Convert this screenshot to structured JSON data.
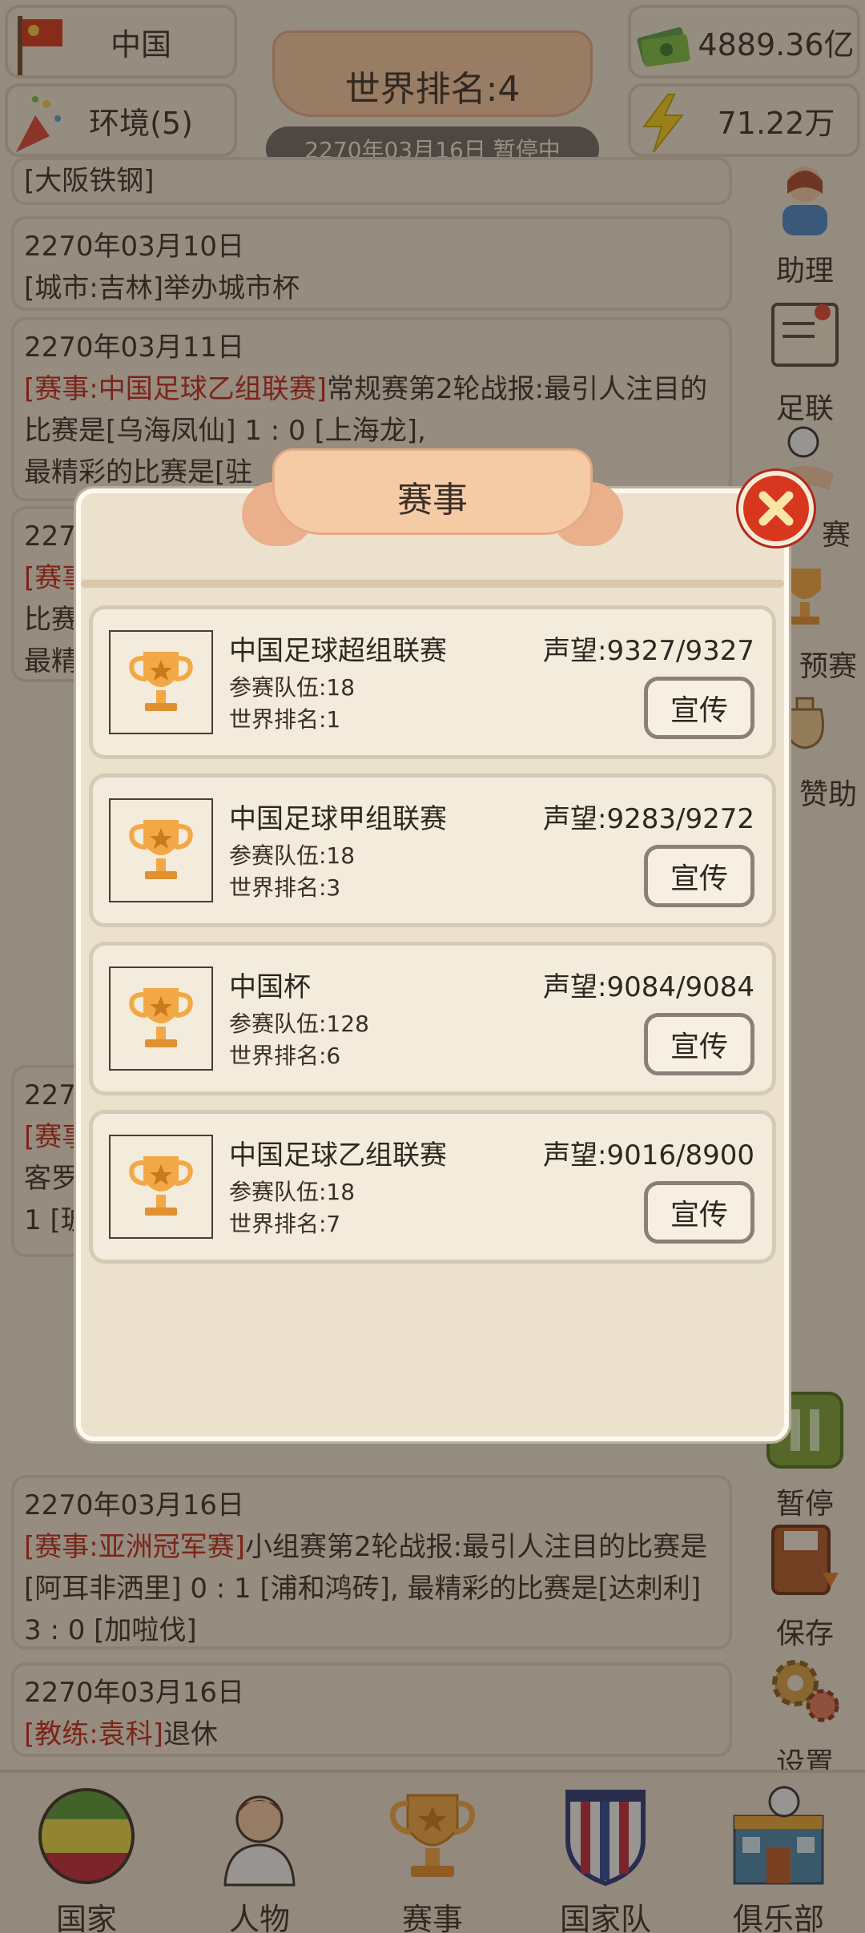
{
  "header": {
    "country_label": "中国",
    "environment_label": "环境(5)",
    "world_rank_title": "世界排名:4",
    "date_status": "2270年03月16日 暂停中",
    "money": "4889.36亿",
    "energy": "71.22万"
  },
  "news": [
    {
      "date": "",
      "tag": "",
      "text": "[大阪铁钢]"
    },
    {
      "date": "2270年03月10日",
      "tag": "",
      "text": "[城市:吉林]举办城市杯"
    },
    {
      "date": "2270年03月11日",
      "tag": "[赛事:中国足球乙组联赛]",
      "text": "常规赛第2轮战报:最引人注目的比赛是[乌海凤仙] 1 : 0 [上海龙],",
      "text2": "最精彩的比赛是[驻"
    },
    {
      "date": "2270年03月16日",
      "tag": "[赛事:亚洲冠军赛]",
      "text": "小组赛第2轮战报:最引人注目的比赛是[阿耳非洒里] 0 : 1 [浦和鸿砖], 最精彩的比赛是[达刺利] 3 : 0 [加啦伐]"
    },
    {
      "date": "2270年03月16日",
      "tag": "[教练:袁科]",
      "text": "退休"
    }
  ],
  "news_partial": [
    "2270",
    "[赛事",
    "比赛",
    "最精",
    "客罗",
    "1 [玻"
  ],
  "side_menu": {
    "assistant": "助理",
    "league": "足联",
    "match_fragment": "赛",
    "prelim_fragment": "预赛",
    "sponsor_fragment": "赞助",
    "pause": "暂停",
    "save": "保存",
    "settings": "设置"
  },
  "bottom_nav": [
    {
      "label": "国家",
      "icon": "flag-circle-icon"
    },
    {
      "label": "人物",
      "icon": "person-icon"
    },
    {
      "label": "赛事",
      "icon": "trophy-icon"
    },
    {
      "label": "国家队",
      "icon": "shield-icon"
    },
    {
      "label": "俱乐部",
      "icon": "clubhouse-icon"
    }
  ],
  "modal": {
    "title": "赛事",
    "close_icon": "close-icon",
    "competitions": [
      {
        "name": "中国足球超组联赛",
        "teams": "参赛队伍:18",
        "rank": "世界排名:1",
        "fame": "声望:9327/9327",
        "promote": "宣传"
      },
      {
        "name": "中国足球甲组联赛",
        "teams": "参赛队伍:18",
        "rank": "世界排名:3",
        "fame": "声望:9283/9272",
        "promote": "宣传"
      },
      {
        "name": "中国杯",
        "teams": "参赛队伍:128",
        "rank": "世界排名:6",
        "fame": "声望:9084/9084",
        "promote": "宣传"
      },
      {
        "name": "中国足球乙组联赛",
        "teams": "参赛队伍:18",
        "rank": "世界排名:7",
        "fame": "声望:9016/8900",
        "promote": "宣传"
      }
    ]
  },
  "colors": {
    "accent_red": "#c0281c",
    "close_red": "#d8361e",
    "trophy_gold": "#f2a844",
    "pause_green": "#7aa43a"
  }
}
